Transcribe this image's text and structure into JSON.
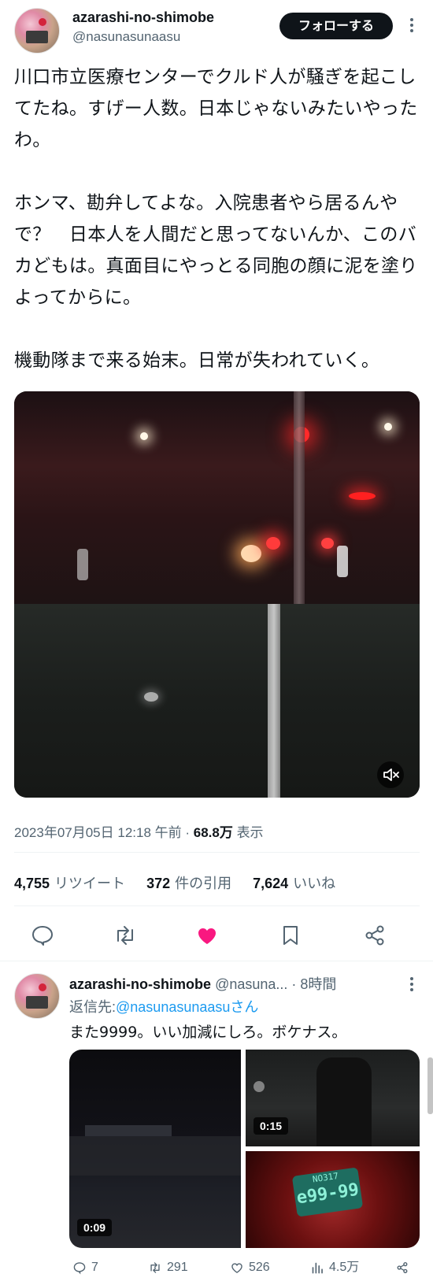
{
  "tweet": {
    "author_name": "azarashi-no-shimobe",
    "author_handle": "@nasunasunaasu",
    "follow_label": "フォローする",
    "text": "川口市立医療センターでクルド人が騒ぎを起こしてたね。すげー人数。日本じゃないみたいやったわ。\n\nホンマ、勘弁してよな。入院患者やら居るんやで？　日本人を人間だと思ってないんか、このバカどもは。真面目にやっとる同胞の顔に泥を塗りよってからに。\n\n機動隊まで来る始末。日常が失われていく。",
    "timestamp": "2023年07月05日 12:18 午前",
    "views_count": "68.8万",
    "views_label": "表示",
    "retweets_count": "4,755",
    "retweets_label": "リツイート",
    "quotes_count": "372",
    "quotes_label": "件の引用",
    "likes_count": "7,624",
    "likes_label": "いいね",
    "accent_like": "#f91880"
  },
  "reply": {
    "author_name": "azarashi-no-shimobe",
    "author_handle_trunc": "@nasuna...",
    "time": "· 8時間",
    "reply_to_prefix": "返信先:",
    "reply_to_handle": "@nasunasunaasuさん",
    "text": "また9999。いい加減にしろ。ボケナス。",
    "media": [
      {
        "duration": "0:09"
      },
      {
        "duration": "0:15"
      },
      {
        "plate_top": "NO317",
        "plate_bottom": "e99-99"
      }
    ],
    "replies": "7",
    "retweets": "291",
    "likes": "526",
    "views": "4.5万"
  },
  "icons": {
    "reply": "reply-icon",
    "retweet": "retweet-icon",
    "like": "heart-icon",
    "bookmark": "bookmark-icon",
    "share": "share-icon",
    "views": "analytics-icon",
    "mute": "mute-icon",
    "more": "more-icon"
  },
  "colors": {
    "link": "#1d9bf0",
    "muted": "#536471",
    "text": "#0f1419"
  }
}
